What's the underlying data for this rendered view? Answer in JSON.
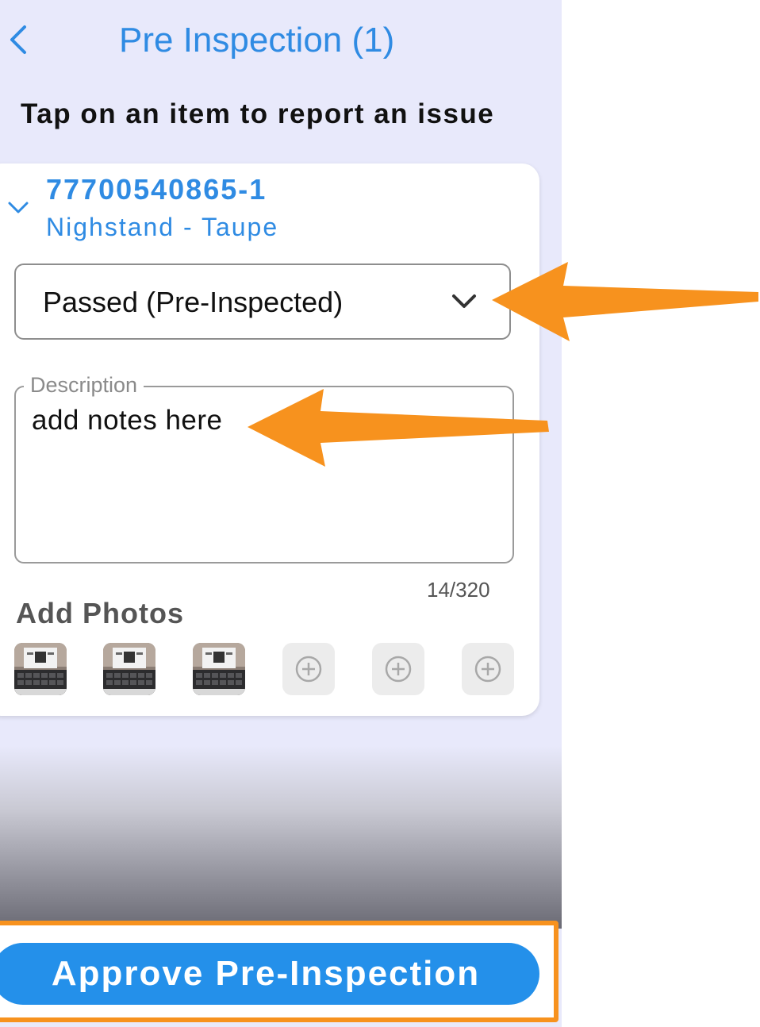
{
  "header": {
    "title": "Pre Inspection (1)"
  },
  "instruction": "Tap on an item to report an issue",
  "item": {
    "number": "77700540865-1",
    "description": "Nighstand - Taupe",
    "status_value": "Passed (Pre-Inspected)",
    "description_field": {
      "label": "Description",
      "value": "add notes here",
      "char_count": "14/320"
    },
    "photos": {
      "label": "Add Photos",
      "attached_count": 3,
      "empty_slots": 3
    }
  },
  "footer": {
    "approve_label": "Approve Pre-Inspection"
  },
  "colors": {
    "accent": "#2f8be3",
    "button": "#2490ea",
    "highlight": "#f7921e",
    "background": "#e8e9fb"
  },
  "icons": [
    "chevron-left-icon",
    "chevron-down-icon",
    "add-circle-icon",
    "annotation-arrow"
  ]
}
